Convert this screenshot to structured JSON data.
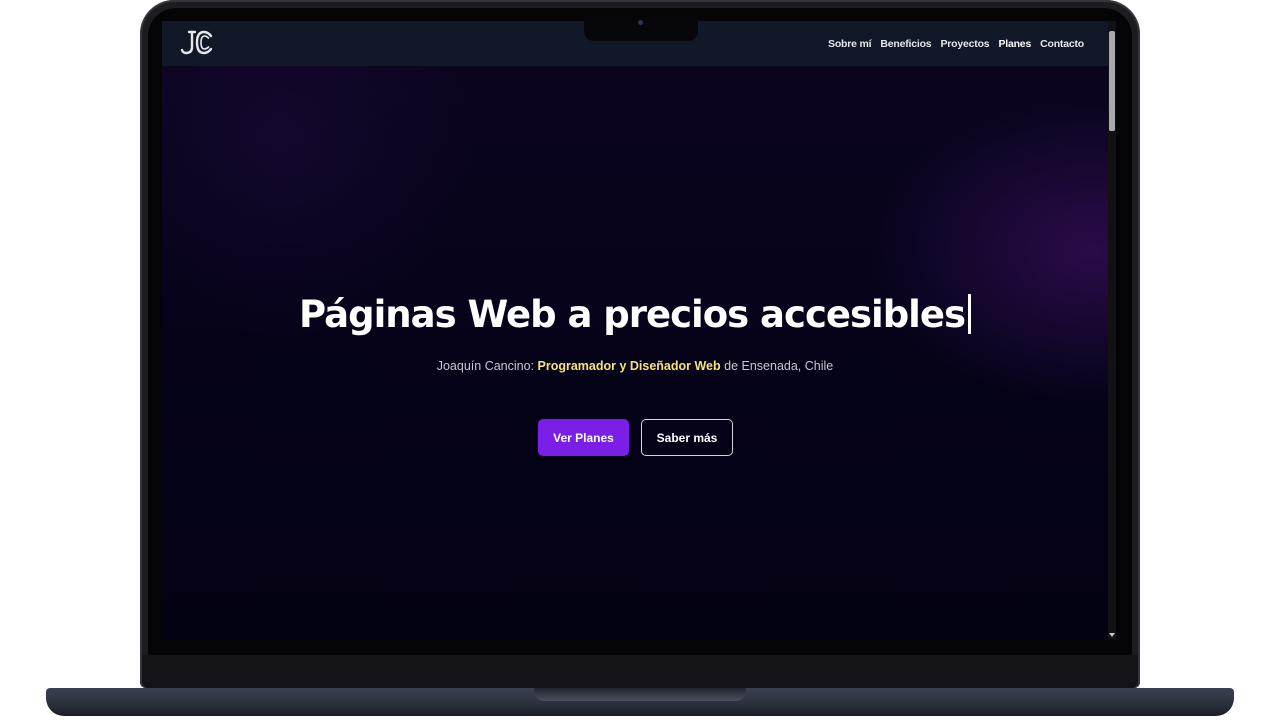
{
  "navbar": {
    "logo_text": "JC",
    "items": [
      {
        "label": "Sobre mí",
        "active": false
      },
      {
        "label": "Beneficios",
        "active": false
      },
      {
        "label": "Proyectos",
        "active": false
      },
      {
        "label": "Planes",
        "active": true
      },
      {
        "label": "Contacto",
        "active": false
      }
    ]
  },
  "hero": {
    "title": "Páginas Web a precios accesibles",
    "subtitle_prefix": "Joaquín Cancino: ",
    "subtitle_highlight": "Programador y Diseñador Web",
    "subtitle_suffix": " de Ensenada, Chile"
  },
  "buttons": {
    "primary_label": "Ver Planes",
    "secondary_label": "Saber más"
  },
  "colors": {
    "navbar_bg": "#111827",
    "accent_purple": "#7b1fe8",
    "highlight_yellow": "#f6e27a",
    "background_dark": "#06031a"
  },
  "icons": {
    "logo": "jc-monogram-logo",
    "scroll_down": "scroll-down-arrow-icon"
  }
}
